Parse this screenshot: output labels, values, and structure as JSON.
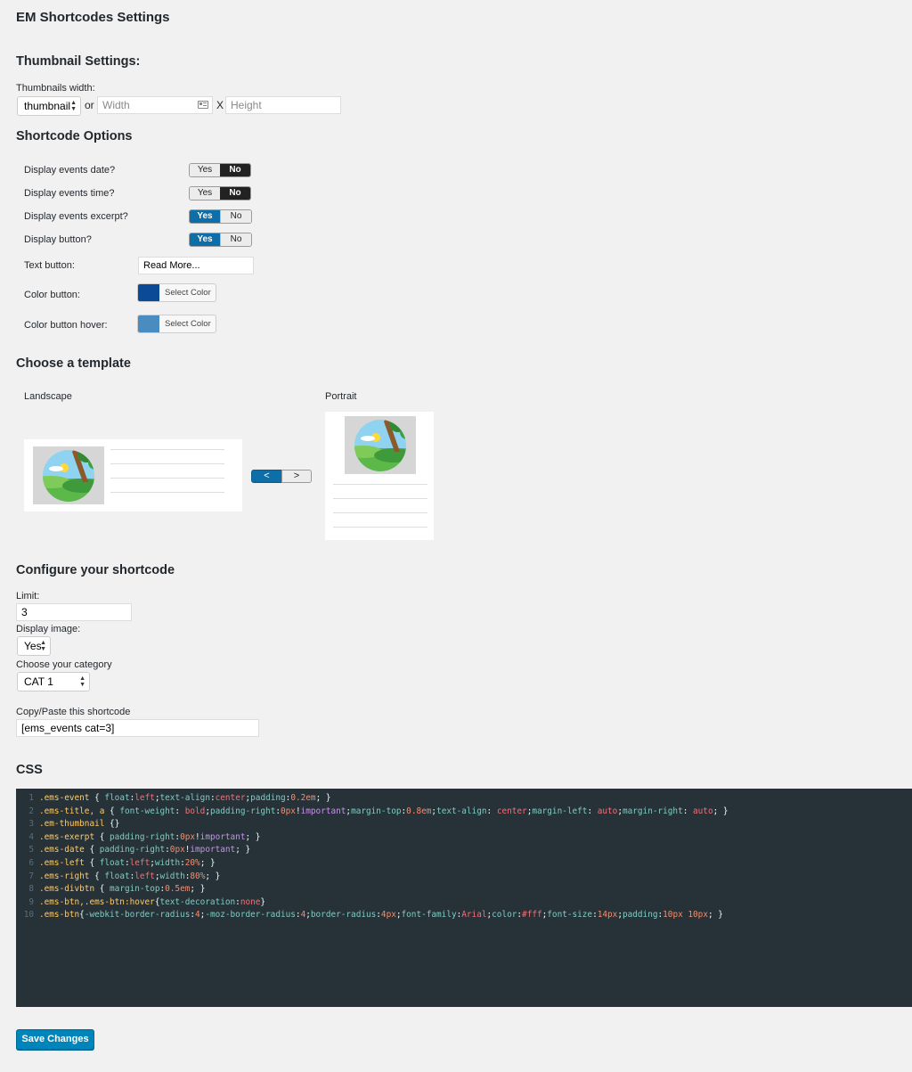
{
  "page_title": "EM Shortcodes Settings",
  "thumbnail": {
    "heading": "Thumbnail Settings:",
    "width_label": "Thumbnails width:",
    "size_select": "thumbnail",
    "or_text": "or",
    "width_placeholder": "Width",
    "x_text": "X",
    "height_placeholder": "Height"
  },
  "options": {
    "heading": "Shortcode Options",
    "yes_label": "Yes",
    "no_label": "No",
    "rows": [
      {
        "label": "Display events date?",
        "value": "No"
      },
      {
        "label": "Display events time?",
        "value": "No"
      },
      {
        "label": "Display events excerpt?",
        "value": "Yes"
      },
      {
        "label": "Display button?",
        "value": "Yes"
      }
    ],
    "text_button_label": "Text button:",
    "text_button_value": "Read More...",
    "color_button_label": "Color button:",
    "color_button_hover_label": "Color button hover:",
    "select_color_label": "Select Color",
    "color_button": "#0b4a96",
    "color_button_hover": "#4a8bc0"
  },
  "template": {
    "heading": "Choose a template",
    "landscape_label": "Landscape",
    "portrait_label": "Portrait",
    "prev_label": "<",
    "next_label": ">",
    "selected": "Landscape"
  },
  "configure": {
    "heading": "Configure your shortcode",
    "limit_label": "Limit:",
    "limit_value": "3",
    "display_image_label": "Display image:",
    "display_image_value": "Yes",
    "category_label": "Choose your category",
    "category_value": "CAT 1",
    "copy_label": "Copy/Paste this shortcode",
    "shortcode_value": "[ems_events cat=3]"
  },
  "css": {
    "heading": "CSS",
    "lines": [
      ".ems-event { float:left;text-align:center;padding:0.2em; }",
      ".ems-title, a { font-weight: bold;padding-right:0px!important;margin-top:0.8em;text-align: center;margin-left: auto;margin-right: auto; }",
      ".em-thumbnail {}",
      ".ems-exerpt { padding-right:0px!important; }",
      ".ems-date { padding-right:0px!important; }",
      ".ems-left { float:left;width:20%; }",
      ".ems-right { float:left;width:80%; }",
      ".ems-divbtn { margin-top:0.5em; }",
      ".ems-btn,.ems-btn:hover{text-decoration:none}",
      ".ems-btn{-webkit-border-radius:4;-moz-border-radius:4;border-radius:4px;font-family:Arial;color:#fff;font-size:14px;padding:10px 10px; }"
    ]
  },
  "save_label": "Save Changes",
  "colors": {
    "accent": "#0085ba",
    "toggle_yes": "#0e6ea8",
    "toggle_no": "#222222",
    "editor_bg": "#263238"
  }
}
